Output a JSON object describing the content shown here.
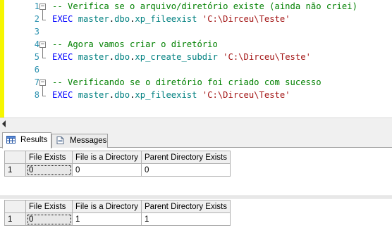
{
  "editor": {
    "lines": [
      {
        "num": "1",
        "tokens": [
          {
            "t": "-- Verifica se o arquivo/diretório existe (ainda não criei)",
            "c": "comment"
          }
        ]
      },
      {
        "num": "2",
        "tokens": [
          {
            "t": "EXEC ",
            "c": "kw"
          },
          {
            "t": "master",
            "c": "obj"
          },
          {
            "t": ".",
            "c": "plain"
          },
          {
            "t": "dbo",
            "c": "obj"
          },
          {
            "t": ".",
            "c": "plain"
          },
          {
            "t": "xp_fileexist ",
            "c": "obj"
          },
          {
            "t": "'C:\\Dirceu\\Teste'",
            "c": "str"
          }
        ]
      },
      {
        "num": "3",
        "tokens": []
      },
      {
        "num": "4",
        "tokens": [
          {
            "t": "-- Agora vamos criar o diretório",
            "c": "comment"
          }
        ]
      },
      {
        "num": "5",
        "tokens": [
          {
            "t": "EXEC ",
            "c": "kw"
          },
          {
            "t": "master",
            "c": "obj"
          },
          {
            "t": ".",
            "c": "plain"
          },
          {
            "t": "dbo",
            "c": "obj"
          },
          {
            "t": ".",
            "c": "plain"
          },
          {
            "t": "xp_create_subdir ",
            "c": "obj"
          },
          {
            "t": "'C:\\Dirceu\\Teste'",
            "c": "str"
          }
        ]
      },
      {
        "num": "6",
        "tokens": []
      },
      {
        "num": "7",
        "tokens": [
          {
            "t": "-- Verificando se o diretório foi criado com sucesso",
            "c": "comment"
          }
        ]
      },
      {
        "num": "8",
        "tokens": [
          {
            "t": "EXEC ",
            "c": "kw"
          },
          {
            "t": "master",
            "c": "obj"
          },
          {
            "t": ".",
            "c": "plain"
          },
          {
            "t": "dbo",
            "c": "obj"
          },
          {
            "t": ".",
            "c": "plain"
          },
          {
            "t": "xp_fileexist ",
            "c": "obj"
          },
          {
            "t": "'C:\\Dirceu\\Teste'",
            "c": "str"
          }
        ]
      }
    ],
    "fold_glyph": "−",
    "colors": {
      "comment": "#008000",
      "kw": "#0000ff",
      "obj": "#008080",
      "str": "#a31515",
      "plain": "#000000",
      "linenum": "#2b91af",
      "change_bar": "#f6f600"
    }
  },
  "tabs": [
    {
      "label": "Results",
      "icon": "results-grid-icon",
      "active": true
    },
    {
      "label": "Messages",
      "icon": "messages-doc-icon",
      "active": false
    }
  ],
  "results": [
    {
      "columns": [
        "File Exists",
        "File is a Directory",
        "Parent Directory Exists"
      ],
      "rows": [
        {
          "rownum": "1",
          "cells": [
            "0",
            "0",
            "0"
          ]
        }
      ]
    },
    {
      "columns": [
        "File Exists",
        "File is a Directory",
        "Parent Directory Exists"
      ],
      "rows": [
        {
          "rownum": "1",
          "cells": [
            "0",
            "1",
            "1"
          ]
        }
      ]
    }
  ]
}
